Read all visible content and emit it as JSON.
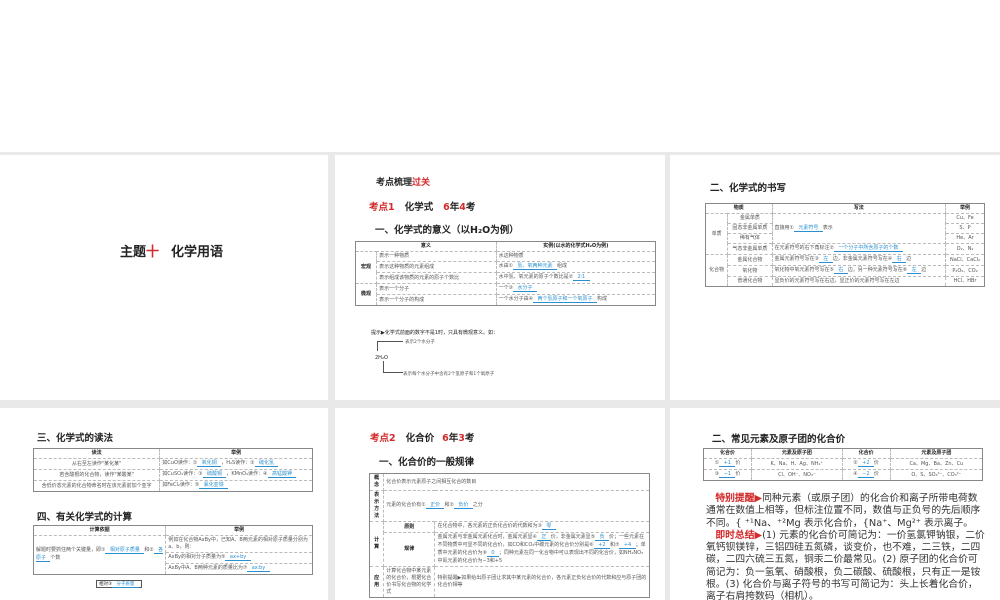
{
  "slide1": {
    "title_prefix": "主题",
    "title_num": "十",
    "title_main": "化学用语"
  },
  "slide2": {
    "kicker_a": "考点梳理",
    "kicker_b": "过关",
    "point": {
      "label": "考点1",
      "name": "化学式",
      "years": "6",
      "year_word": "年",
      "count": "4",
      "exam_word": "考"
    },
    "section": "一、化学式的意义（以H₂O为例）",
    "table": [
      [
        {
          "t": "意义",
          "cs": 2,
          "h": 1
        },
        {
          "t": "实例(以水的化学式H₂O为例)",
          "h": 1
        }
      ],
      [
        {
          "t": "宏观",
          "rs": 3,
          "h": 1
        },
        {
          "t": "表示一种物质"
        },
        {
          "t": "水这种物质"
        }
      ],
      [
        {
          "t": "表示这种物质的元素组成"
        },
        {
          "t": "水由①[氢、氧两种元素]组成"
        }
      ],
      [
        {
          "t": "表示组成该物质的元素的原子个数比"
        },
        {
          "t": "水中氢、氧元素的原子个数比是②[2∶1]"
        }
      ],
      [
        {
          "t": "微观",
          "rs": 2,
          "h": 1
        },
        {
          "t": "表示一个分子"
        },
        {
          "t": "一个③[水分子]"
        }
      ],
      [
        {
          "t": "表示一个分子的构成"
        },
        {
          "t": "一个水分子由④[两个氢原子和一个氧原子]构成"
        }
      ]
    ],
    "note": "提示▶化学式前面的数字不是1时，只具有微观意义。如：",
    "note_a": "表示2个水分子",
    "note_formula": "2H₂O",
    "note_b": "表示每个水分子中含有2个氢原子和1个氧原子"
  },
  "slide3": {
    "section": "二、化学式的书写",
    "table": [
      [
        {
          "t": "物质",
          "cs": 2,
          "h": 1
        },
        {
          "t": "写法",
          "h": 1
        },
        {
          "t": "举例",
          "h": 1
        }
      ],
      [
        {
          "t": "单质",
          "rs": 4,
          "c": 1
        },
        {
          "t": "金属单质",
          "c": 1
        },
        {
          "t": "直接用①[元素符号]表示",
          "rs": 3
        },
        {
          "t": "Cu、Fe",
          "c": 1
        }
      ],
      [
        {
          "t": "固态非金属单质",
          "c": 1
        },
        {
          "t": "S、P",
          "c": 1
        }
      ],
      [
        {
          "t": "稀有气体",
          "c": 1
        },
        {
          "t": "He、Ar",
          "c": 1
        }
      ],
      [
        {
          "t": "气态非金属单质",
          "c": 1
        },
        {
          "t": "在元素符号的右下角标注②[一个分子中所含原子的个数]"
        },
        {
          "t": "O₂、N₂",
          "c": 1
        }
      ],
      [
        {
          "t": "化合物",
          "rs": 3,
          "c": 1
        },
        {
          "t": "金属化合物",
          "c": 1
        },
        {
          "t": "金属元素符号写在③[左]边，非金属元素符号写在④[右]边"
        },
        {
          "t": "NaCl、CaCl₂",
          "c": 1
        }
      ],
      [
        {
          "t": "氧化物",
          "c": 1
        },
        {
          "t": "氧化物中氧元素符号写在⑤[右]边，另一种元素符号写在⑥[左]边"
        },
        {
          "t": "P₂O₅、CO₂",
          "c": 1
        }
      ],
      [
        {
          "t": "普通化合物",
          "c": 1
        },
        {
          "t": "显负价的元素符号写在右边，显正价的元素符号写在左边"
        },
        {
          "t": "HCl、HBr",
          "c": 1
        }
      ]
    ]
  },
  "slide4": {
    "section3": "三、化学式的读法",
    "table3": [
      [
        {
          "t": "读法",
          "h": 1
        },
        {
          "t": "举例",
          "h": 1
        }
      ],
      [
        {
          "t": "从右至左读作\"某化某\"",
          "c": 1
        },
        {
          "t": "如CuO读作：①[氧化铜]，H₂S读作：②[硫化氢]"
        }
      ],
      [
        {
          "t": "若含酸根的化合物，读作\"某酸某\"",
          "c": 1
        },
        {
          "t": "如CuSO₄读作：③[硫酸铜]，KMnO₄读作：④[高锰酸钾]"
        }
      ],
      [
        {
          "t": "含低价态元素的化合物命名时在该元素前加个亚字",
          "c": 1
        },
        {
          "t": "如FeCl₂读作：⑤[氯化亚铁]"
        }
      ]
    ],
    "section4": "四、有关化学式的计算",
    "table4": [
      [
        {
          "t": "计算依据",
          "h": 1
        },
        {
          "t": "举例",
          "h": 1
        }
      ],
      [
        {
          "t": "解题时要抓住两个关键量，即①[相对原子质量]和②[各原子]个数",
          "rs": 3
        },
        {
          "t": "例如在化合物AxBy中，已知A、B两元素的相对原子质量分别为a、b，则："
        }
      ],
      [
        {
          "t": "AxBy的相对分子质量为⑤[ax+by]"
        }
      ],
      [
        {
          "t": "AxBy中A、B两种元素的质量比为⑦[ax∶by]"
        }
      ]
    ],
    "diagram_label": "相对③[分子质量]"
  },
  "slide5": {
    "point": {
      "label": "考点2",
      "name": "化合价",
      "years": "6",
      "year_word": "年",
      "count": "3",
      "exam_word": "考"
    },
    "section": "一、化合价的一般规律",
    "table": [
      [
        {
          "t": "概念",
          "h": 1
        },
        {
          "t": "化合价表示元素原子之间相互化合的数目",
          "cs": 2
        }
      ],
      [
        {
          "t": "表示方法",
          "h": 1
        },
        {
          "t": "元素的化合价有①[正价]和②[负价]之分",
          "cs": 2
        }
      ],
      [
        {
          "t": "计算",
          "rs": 2,
          "h": 1
        },
        {
          "t": "原则",
          "h": 1
        },
        {
          "t": "在化合物中，各元素的正负化合价的代数和为③[零]"
        }
      ],
      [
        {
          "t": "规律",
          "h": 1
        },
        {
          "t": "金属元素与非金属元素化合时，金属元素显④[正]价，非金属元素显⑤[负]价；一些元素在不同物质中可显不同的化合价，如CO和CO₂中碳元素的化合价分别是⑥[+2]和⑦[+4]；单质中元素的化合价为⑧[0]；同种元素在同一化合物中可以表现出不同的化合价，如NH₄NO₃中氮元素的化合价为−3和+5"
        }
      ],
      [
        {
          "t": "应用",
          "h": 1
        },
        {
          "t": "计算化合物中某元素的化合价，根据化合价书写化合物的化学式"
        },
        {
          "t": "特别提醒▶如果给出原子团让求其中某元素的化合价，各元素正负化合价的代数和应与原子团的化合价相等"
        }
      ]
    ]
  },
  "slide6": {
    "section": "二、常见元素及原子团的化合价",
    "table": [
      [
        {
          "t": "化合价",
          "h": 1
        },
        {
          "t": "元素及原子团",
          "h": 1
        },
        {
          "t": "化合价",
          "h": 1
        },
        {
          "t": "元素及原子团",
          "h": 1
        }
      ],
      [
        {
          "t": "①[+1]价",
          "c": 1
        },
        {
          "t": "K、Na、H、Ag、NH₄⁺",
          "c": 1
        },
        {
          "t": "②[+2]价",
          "c": 1
        },
        {
          "t": "Ca、Mg、Ba、Zn、Cu",
          "c": 1
        }
      ],
      [
        {
          "t": "③[−1]价",
          "c": 1
        },
        {
          "t": "Cl、OH⁻、NO₃⁻",
          "c": 1
        },
        {
          "t": "④[−2]价",
          "c": 1
        },
        {
          "t": "O、S、SO₄²⁻、CO₃²⁻",
          "c": 1
        }
      ]
    ],
    "tip_label": "特别提醒▶",
    "tip_text": "同种元素（或原子团）的化合价和离子所带电荷数通常在数值上相等，但标注位置不同，数值与正负号的先后顺序不同。{ ⁺¹Na、⁺²Mg 表示化合价，{Na⁺、Mg²⁺ 表示离子。",
    "sum_label": "即时总结▶",
    "sum_text": "(1) 元素的化合价可简记为：一价氢氯钾钠银，二价氧钙钡镁锌，三铝四硅五氮磷，谈变价，也不难，二三铁，二四碳，二四六硫三五氮，铜汞二价最常见。(2) 原子团的化合价可简记为：负一氢氧、硝酸根，负二碳酸、硫酸根，只有正一是铵根。(3) 化合价与离子符号的书写可简记为：头上长着化合价，离子右肩挎数码（相机）。"
  }
}
